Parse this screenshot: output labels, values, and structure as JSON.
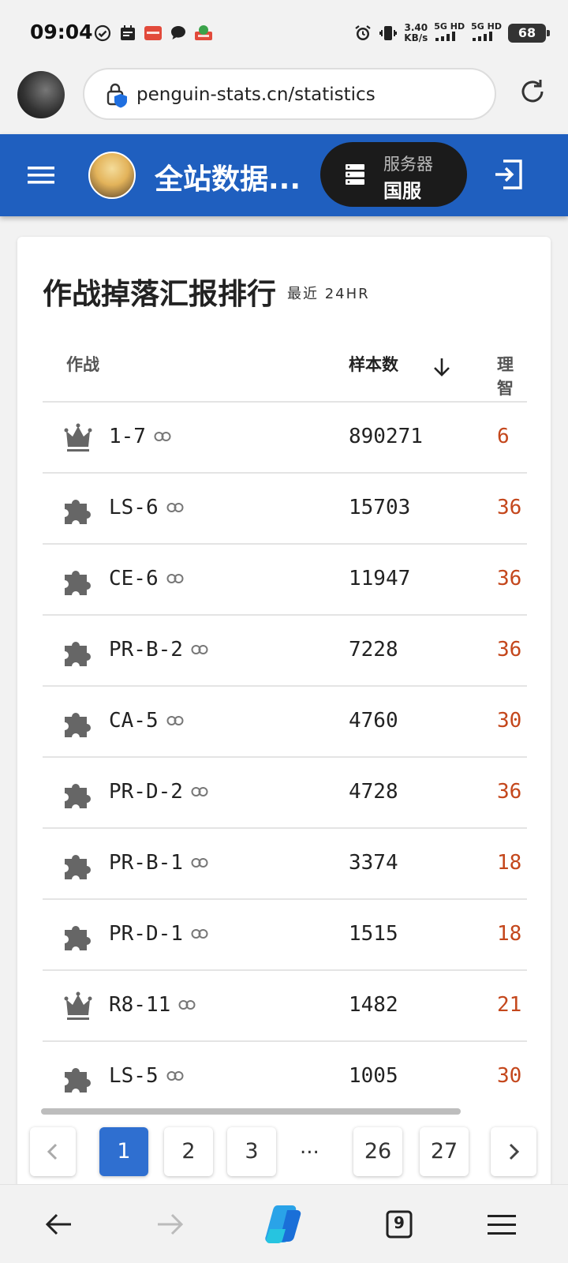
{
  "status_bar": {
    "time": "09:04",
    "net_speed_value": "3.40",
    "net_speed_unit": "KB/s",
    "sim1": "5G HD",
    "sim2": "5G HD",
    "battery": "68",
    "icons": [
      "check-circle-icon",
      "calendar-icon",
      "wallet-app-icon",
      "chat-bubble-icon",
      "game-app-icon",
      "alarm-icon",
      "vibrate-icon"
    ]
  },
  "browser": {
    "url": "penguin-stats.cn/statistics",
    "tabs_count": "9"
  },
  "header": {
    "title": "全站数据...",
    "server_label": "服务器",
    "server_value": "国服"
  },
  "card": {
    "title": "作战掉落汇报排行",
    "subtitle": "最近 24HR",
    "columns": {
      "stage": "作战",
      "samples": "样本数",
      "sanity": "理智"
    },
    "rows": [
      {
        "icon": "crown-icon",
        "stage": "1-7",
        "samples": "890271",
        "sanity": "6"
      },
      {
        "icon": "puzzle-icon",
        "stage": "LS-6",
        "samples": "15703",
        "sanity": "36"
      },
      {
        "icon": "puzzle-icon",
        "stage": "CE-6",
        "samples": "11947",
        "sanity": "36"
      },
      {
        "icon": "puzzle-icon",
        "stage": "PR-B-2",
        "samples": "7228",
        "sanity": "36"
      },
      {
        "icon": "puzzle-icon",
        "stage": "CA-5",
        "samples": "4760",
        "sanity": "30"
      },
      {
        "icon": "puzzle-icon",
        "stage": "PR-D-2",
        "samples": "4728",
        "sanity": "36"
      },
      {
        "icon": "puzzle-icon",
        "stage": "PR-B-1",
        "samples": "3374",
        "sanity": "18"
      },
      {
        "icon": "puzzle-icon",
        "stage": "PR-D-1",
        "samples": "1515",
        "sanity": "18"
      },
      {
        "icon": "crown-icon",
        "stage": "R8-11",
        "samples": "1482",
        "sanity": "21"
      },
      {
        "icon": "puzzle-icon",
        "stage": "LS-5",
        "samples": "1005",
        "sanity": "30"
      }
    ]
  },
  "pagination": {
    "pages": [
      "1",
      "2",
      "3"
    ],
    "ellipsis": "...",
    "last_pages": [
      "26",
      "27"
    ],
    "current": "1"
  },
  "colors": {
    "header_bg": "#1f5fbf",
    "sanity_text": "#c4471c",
    "active_page": "#2f6fd0"
  }
}
